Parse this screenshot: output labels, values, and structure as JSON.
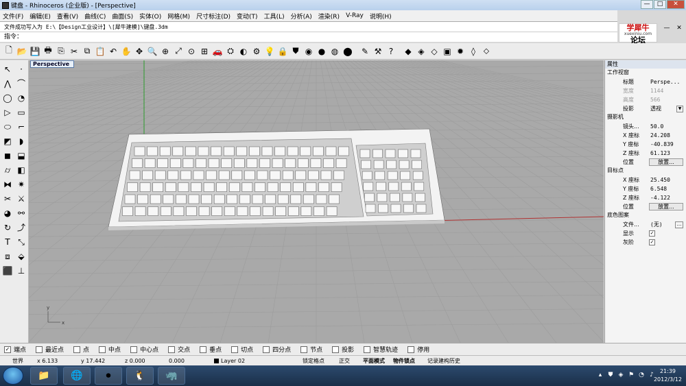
{
  "window": {
    "title": "键盘 - Rhinoceros (企业版) - [Perspective]"
  },
  "menu": [
    "文件(F)",
    "编辑(E)",
    "查看(V)",
    "曲线(C)",
    "曲面(S)",
    "实体(O)",
    "网格(M)",
    "尺寸标注(D)",
    "变动(T)",
    "工具(L)",
    "分析(A)",
    "渲染(R)",
    "V-Ray",
    "说明(H)"
  ],
  "command": {
    "history": "文件成功写入为 E:\\【Design工业设计】\\[犀牛建模]\\键盘.3dm",
    "prompt": "指令："
  },
  "logo": {
    "line1": "学犀牛",
    "line2": "xuexiniu.com",
    "line3": "论坛"
  },
  "viewport": {
    "tab": "Perspective"
  },
  "properties": {
    "header": "属性",
    "viewport_section": "工作视窗",
    "title_label": "标题",
    "title_value": "Perspe...",
    "width_label": "宽度",
    "width_value": "1144",
    "height_label": "高度",
    "height_value": "566",
    "projection_label": "投影",
    "projection_value": "透视",
    "camera_section": "摄影机",
    "lens_label": "镜头...",
    "lens_value": "50.0",
    "cx_label": "X 座标",
    "cx_value": "24.208",
    "cy_label": "Y 座标",
    "cy_value": "-40.839",
    "cz_label": "Z 座标",
    "cz_value": "61.123",
    "cpos_label": "位置",
    "cpos_button": "放置...",
    "target_section": "目标点",
    "tx_label": "X 座标",
    "tx_value": "25.450",
    "ty_label": "Y 座标",
    "ty_value": "6.548",
    "tz_label": "Z 座标",
    "tz_value": "-4.122",
    "tpos_label": "位置",
    "tpos_button": "放置...",
    "bg_section": "底色图案",
    "file_label": "文件...",
    "file_value": "(无)",
    "show_label": "显示",
    "gray_label": "灰阶"
  },
  "snaps": [
    {
      "label": "端点",
      "checked": true
    },
    {
      "label": "最近点",
      "checked": false
    },
    {
      "label": "点",
      "checked": false
    },
    {
      "label": "中点",
      "checked": false
    },
    {
      "label": "中心点",
      "checked": false
    },
    {
      "label": "交点",
      "checked": false
    },
    {
      "label": "垂点",
      "checked": false
    },
    {
      "label": "切点",
      "checked": false
    },
    {
      "label": "四分点",
      "checked": false
    },
    {
      "label": "节点",
      "checked": false
    },
    {
      "label": "投影",
      "checked": false
    },
    {
      "label": "智慧轨迹",
      "checked": false
    },
    {
      "label": "停用",
      "checked": false
    }
  ],
  "status": {
    "cplane": "世界",
    "x": "x 6.133",
    "y": "y 17.442",
    "z": "z 0.000",
    "dist": "0.000",
    "layer": "Layer 02",
    "lock": "锁定格点",
    "ortho": "正交",
    "planar": "平面模式",
    "osnap": "物件锁点",
    "history": "记录建构历史"
  },
  "clock": {
    "time": "21:39",
    "date": "2012/3/12"
  },
  "colors": {
    "viewport_bg": "#a9a9a9",
    "grid": "#9a9a9a",
    "x_axis": "#b03030",
    "y_axis": "#2a9a2a",
    "model": "#f2f2f2"
  }
}
